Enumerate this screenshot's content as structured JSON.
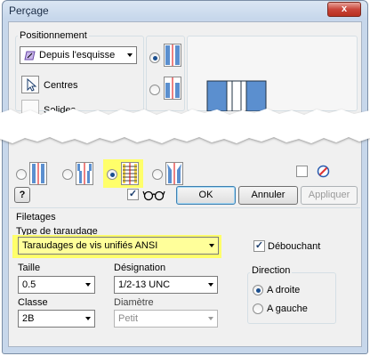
{
  "window": {
    "title": "Perçage",
    "close_glyph": "x"
  },
  "positioning": {
    "label": "Positionnement",
    "placement_value": "Depuis l'esquisse",
    "centers_label": "Centres",
    "solids_label": "Solides"
  },
  "hole_types": {
    "selected_index": 2,
    "highlight_color": "#ffff6a"
  },
  "buttons": {
    "help_glyph": "?",
    "ok": "OK",
    "cancel": "Annuler",
    "apply": "Appliquer"
  },
  "threads": {
    "section_label": "Filetages",
    "type_label": "Type de taraudage",
    "type_value": "Taraudages de vis unifiés ANSI",
    "through_label": "Débouchant",
    "through_checked": true,
    "size_label": "Taille",
    "size_value": "0.5",
    "designation_label": "Désignation",
    "designation_value": "1/2-13 UNC",
    "class_label": "Classe",
    "class_value": "2B",
    "diameter_label": "Diamètre",
    "diameter_value": "Petit",
    "direction_label": "Direction",
    "direction_right": "A droite",
    "direction_left": "A gauche",
    "direction_selected": "right"
  },
  "icons": [
    "close-icon",
    "sketch-icon",
    "pointer-icon",
    "hole-icon",
    "help-icon",
    "glasses-icon",
    "check-icon"
  ]
}
